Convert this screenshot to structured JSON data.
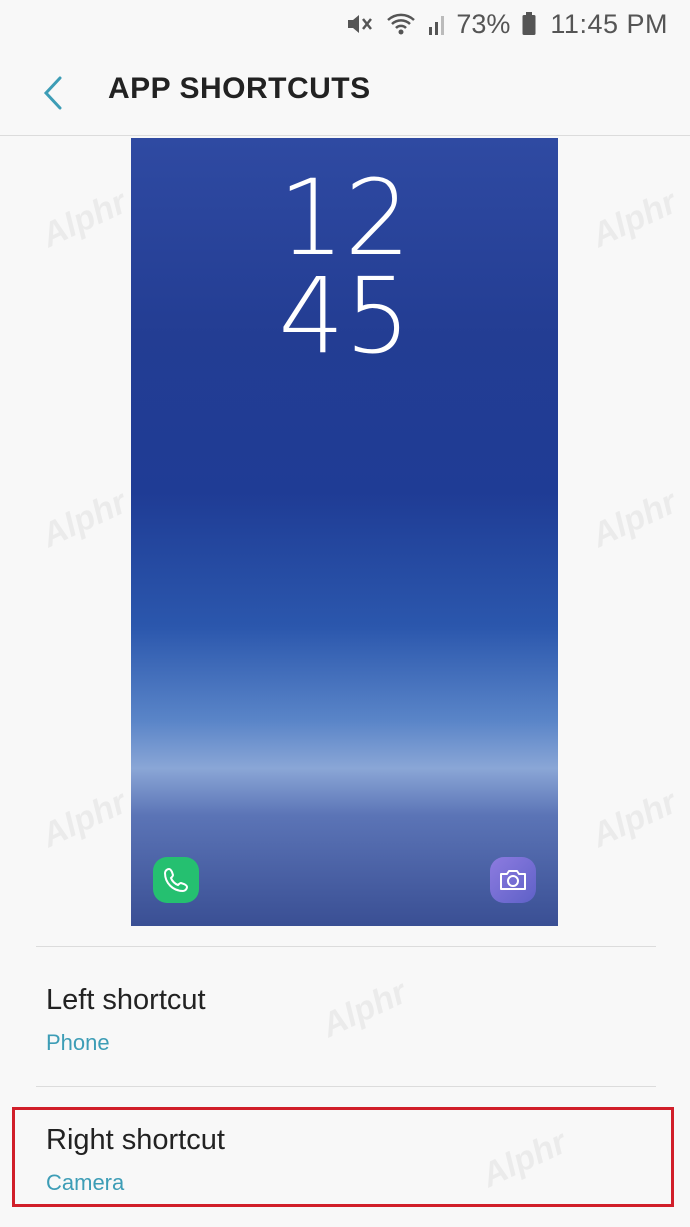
{
  "status_bar": {
    "battery_percent": "73%",
    "time": "11:45 PM",
    "icons": [
      "mute-icon",
      "wifi-icon",
      "signal-icon",
      "battery-icon"
    ]
  },
  "header": {
    "title": "APP SHORTCUTS",
    "back_icon": "chevron-left-icon"
  },
  "preview": {
    "clock_hours": "12",
    "clock_minutes": "45",
    "left_icon": "phone-icon",
    "right_icon": "camera-icon"
  },
  "settings": {
    "left": {
      "title": "Left shortcut",
      "value": "Phone"
    },
    "right": {
      "title": "Right shortcut",
      "value": "Camera"
    }
  },
  "watermark": "Alphr",
  "colors": {
    "accent": "#3d9db6",
    "highlight": "#d11f2a",
    "phone_green": "#25c070",
    "camera_purple": "#7a6fd6"
  }
}
